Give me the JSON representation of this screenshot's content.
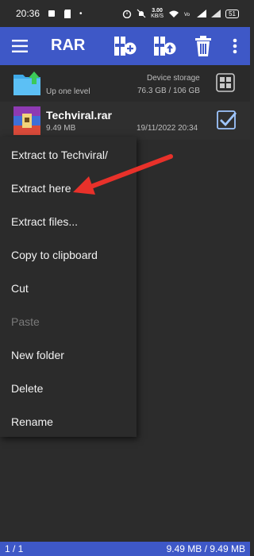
{
  "status_bar": {
    "time": "20:36",
    "speed_value": "3.00",
    "speed_unit": "KB/S",
    "battery": "51"
  },
  "app_bar": {
    "title": "RAR"
  },
  "up_row": {
    "label": "Up one level",
    "storage_label": "Device storage",
    "storage_size": "76.3 GB / 106 GB"
  },
  "file_row": {
    "name": "Techviral.rar",
    "size": "9.49 MB",
    "date": "19/11/2022 20:34"
  },
  "context_menu": {
    "items": [
      {
        "label": "Extract to Techviral/"
      },
      {
        "label": "Extract here"
      },
      {
        "label": "Extract files..."
      },
      {
        "label": "Copy to clipboard"
      },
      {
        "label": "Cut"
      },
      {
        "label": "Paste"
      },
      {
        "label": "New folder"
      },
      {
        "label": "Delete"
      },
      {
        "label": "Rename"
      }
    ]
  },
  "bottom_bar": {
    "page": "1 / 1",
    "selection_size": "9.49 MB / 9.49 MB"
  },
  "colors": {
    "accent": "#3e58c7",
    "annotation_arrow": "#e8312a"
  }
}
